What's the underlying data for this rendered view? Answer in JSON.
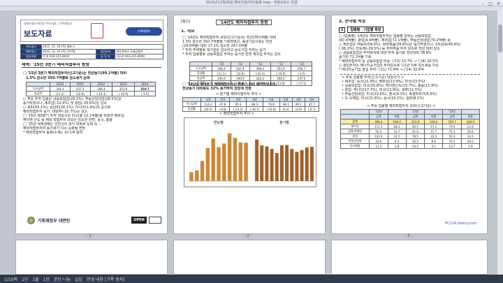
{
  "window": {
    "title": "2015년12월09일 해외건설(FDI)동향.hwp - 한컴오피스 한글"
  },
  "page1": {
    "top_caption": "경제부총리·재정부 보도자료 | 기획재정부",
    "doc_type": "보도자료",
    "badge": "기획재정부",
    "meta_rows": [
      [
        "보도일시",
        "2015. 12. 10.(목) 배포시"
      ],
      [
        "배포일시",
        "2015. 12. 10.(목) 10:00",
        "담당부서",
        "대외경제국 국제금융과"
      ],
      [
        "담당과장",
        "전 화 044-215-8000",
        "담 당 자",
        "사무관 044-215-8000"
      ]
    ],
    "headline": "제목: '15년 3분기 해외직접투자 동향",
    "summary_lines": [
      "□ '15년 3분기 해외직접투자(신고기준)는 전년동기(99.1억불) 대비",
      "1.5% 감소한 350.7억불로 감소세가 둔화"
    ],
    "table": {
      "header": [
        "",
        "2010",
        "2011",
        "2012",
        "2013",
        "2014"
      ],
      "rows": [
        [
          "신고금액",
          "344.4",
          "437.4",
          "396.4",
          "353.9",
          "350.7"
        ],
        [
          "송금액",
          "(11.2)",
          "(32.8)",
          "(-10.3)",
          "(-10.9)",
          "(-1.5)"
        ]
      ]
    },
    "bullets": [
      "○ 주요 투자 업종은 금융보험업(29.1%), 부동산임대업(28.5%)은",
      "증가하였으나, 제조업(-12.9%) 및 광업(-35.6%)은 감소",
      "○ 북미(55.1%), 중남미(26.1%), 아시아(1.4%)의 순으로",
      "해외직접투자 증가, 대양주(-32.7%)는 감소",
      "□ '15년 제3분기 투자 대상국은 미국(총 12.1억불)을 비롯한 베트남,",
      "케이맨 군도 등 해외 직접투자 규모는 감소한 반면, 중국, 홍콩",
      "□ '15년 세계경제는 선진국의 경기 회복세 둔화 속 ...",
      "해외직접투자의 증가세가 다소 둔화될 전망",
      "* 해외직접투자 동향(누계): 10.1억 달러"
    ],
    "footer_logo": "기획재정부 대변인",
    "footer_badge": "OPEN"
  },
  "page2": {
    "tag": "[참고]",
    "title": "'14년도 해외직접투자 동향",
    "section": "1. 개요",
    "paras": [
      "□ '14년도 해외직접투자 규모(신고기준)는 전년(351억불) 대비",
      "1.5% 감소한 350.7억불을 기록하였고, 송금기준으로는 전년",
      "(29.6억불) 대비 17.1% 감소한 247.0억불",
      "* 투자 주체별로 대기업은 감소하고 중소기업 투자는 증가",
      "* 투자 업종별로 금융보험업 투자는 증가한 반면 제조업 투자는 감소"
    ],
    "table1": {
      "header": [
        "",
        "'10",
        "'11",
        "'12",
        "'13",
        "'14"
      ],
      "rows": [
        [
          "신고금액",
          "344.4",
          "437.4",
          "396.4",
          "353.9",
          "350.7"
        ],
        [
          "증감률",
          "(11.2)",
          "(32.8)",
          "(-10.3)",
          "(-10.9)",
          "(-1.5)"
        ],
        [
          "송금액",
          "226.6",
          "290.0",
          "264.2",
          "298.2",
          "247.0"
        ],
        [
          "증감률",
          "(12.4)",
          "(28.0)",
          "(-8.9)",
          "(12.8)",
          "(-17.1)"
        ]
      ]
    },
    "para2": [
      "□ '14년도 4/4분기 해외직접투자는 전분기 대비 증가하였으며,",
      "전년동기 대비로도 32% 증가하여 성장세 전환"
    ],
    "table2_title": "< 분기별 해외직접투자 추이 >",
    "table2": {
      "header": [
        "",
        "1/4",
        "2/4",
        "3/4",
        "4/4",
        "1/4",
        "2/4",
        "3/4",
        "4/4"
      ],
      "rows": [
        [
          "신고금액",
          "114.2",
          "97.8",
          "95.4",
          "88.3",
          "76.8",
          "98.1",
          "99.1",
          "87.7"
        ],
        [
          "증감률",
          "(30.5)",
          "(-8.8)",
          "(-13.5)",
          "(-10.7)",
          "(-32.8)",
          "(0.3)",
          "(3.9)",
          "(-0.7)"
        ]
      ]
    },
    "chart_title": "< 해외직접투자 추이 >",
    "chart_data": [
      {
        "type": "bar",
        "title": "연도별",
        "categories": [
          "'04",
          "'05",
          "'06",
          "'07",
          "'08",
          "'09",
          "'10",
          "'11",
          "'12",
          "'13",
          "'14"
        ],
        "values": [
          81,
          96,
          184,
          302,
          390,
          310,
          344,
          437,
          396,
          354,
          351
        ],
        "ylim": [
          0,
          500
        ]
      },
      {
        "type": "bar",
        "title": "분기별",
        "categories": [
          "1/4",
          "2/4",
          "3/4",
          "4/4",
          "1/4",
          "2/4",
          "3/4",
          "4/4",
          "1/4",
          "2/4",
          "3/4",
          "4/4"
        ],
        "values": [
          114,
          98,
          95,
          88,
          77,
          98,
          99,
          88,
          80,
          85,
          92,
          94
        ],
        "ylim": [
          0,
          150
        ]
      }
    ]
  },
  "page3": {
    "section": "2. 분야별 특징",
    "box_num": "1",
    "box_title": "업종별 · 기업별 특징",
    "paras": [
      "□ (업종별) '14년도 해외직접투자는 업종별 순위는 금융보험업",
      "(87.4억불), 광업(9.9억불), 제조업(72.1억불), 부동산임대업(70.2억불) 순",
      "○ 제조업은 자동차(59.0%), 화학제품(29.6%)은 증가하였으나, 1차금속(45.6%)",
      "(-36.2%), 반도체(-29.5%) 등 전자부품 투자 감소로 전년 대비 감소",
      "○ 금융보험업은 투자회사에 대한 투자 증가로 전년대비 78.8%",
      "증가한 72.1억불 기록",
      "* 해외직접투자 중 금융보험업 비중: ('13) 15.7% → ('14) 20.5%",
      "○ 광업투자는 에너지공기업의 투자감소로 '11년 이후 감소세를 지속",
      "* 에너지공기업 광업 투자: ('11) 71.8억 → ('14) 32.6억"
    ],
    "sub": [
      "< 주요 업종별 투자(신고기준) 대상국가 >",
      "• 제조업: 중국(21.8%), 베트남(13.9%), 미국(23.5%)",
      "• 금융보험업: 미국(25.8%), 케이맨군도(15.7%), 홍콩(11.9%)",
      "• 광업: 캐나다(17.7%), 미국(13.9%), 호주(11.5%)",
      "• 부동산임대업: 미국(22.6%), 영국(9.3%), 룩셈부르크(5.6%)",
      "• 도·소매업: 미국(21.8%), 중국(16.1%), 일본(8.1%)"
    ],
    "table_title": "< 주요 업종별 해외직접투자 규모(신고기준) >",
    "table": {
      "header": [
        "",
        "'12년",
        "",
        "'13년",
        "",
        "'14년",
        ""
      ],
      "header2": [
        "",
        "금액",
        "비중",
        "금액",
        "비중",
        "금액",
        "비중"
      ],
      "rows": [
        [
          "합계",
          "396.4",
          "100.0",
          "353.9",
          "100.0",
          "350.7",
          "100.0"
        ],
        [
          "제조업",
          "111.5",
          "28.1",
          "96.0",
          "27.1",
          "79.9",
          "22.8"
        ],
        [
          "금융·보험업",
          "50.3",
          "12.7",
          "41.4",
          "11.7",
          "72.1",
          "20.6"
        ],
        [
          "광업",
          "124.9",
          "31.5",
          "78.5",
          "22.2",
          "50.3",
          "14.3"
        ],
        [
          "부동산임대",
          "33.0",
          "8.3",
          "30.5",
          "8.6",
          "70.2",
          "20.0"
        ],
        [
          "도소매업",
          "11.2",
          "2.8",
          "14.4",
          "4.1",
          "13.7",
          "3.9"
        ]
      ]
    },
    "watermark": "PC114.tistory.com"
  },
  "page_numbers": [
    "- 1 -",
    "- 2 -",
    "- 3 -"
  ],
  "statusbar": [
    "1/10쪽",
    "1단",
    "1줄",
    "1칸",
    "문단 나눔",
    "삽입",
    "변경 내용 [기록 중지]"
  ]
}
